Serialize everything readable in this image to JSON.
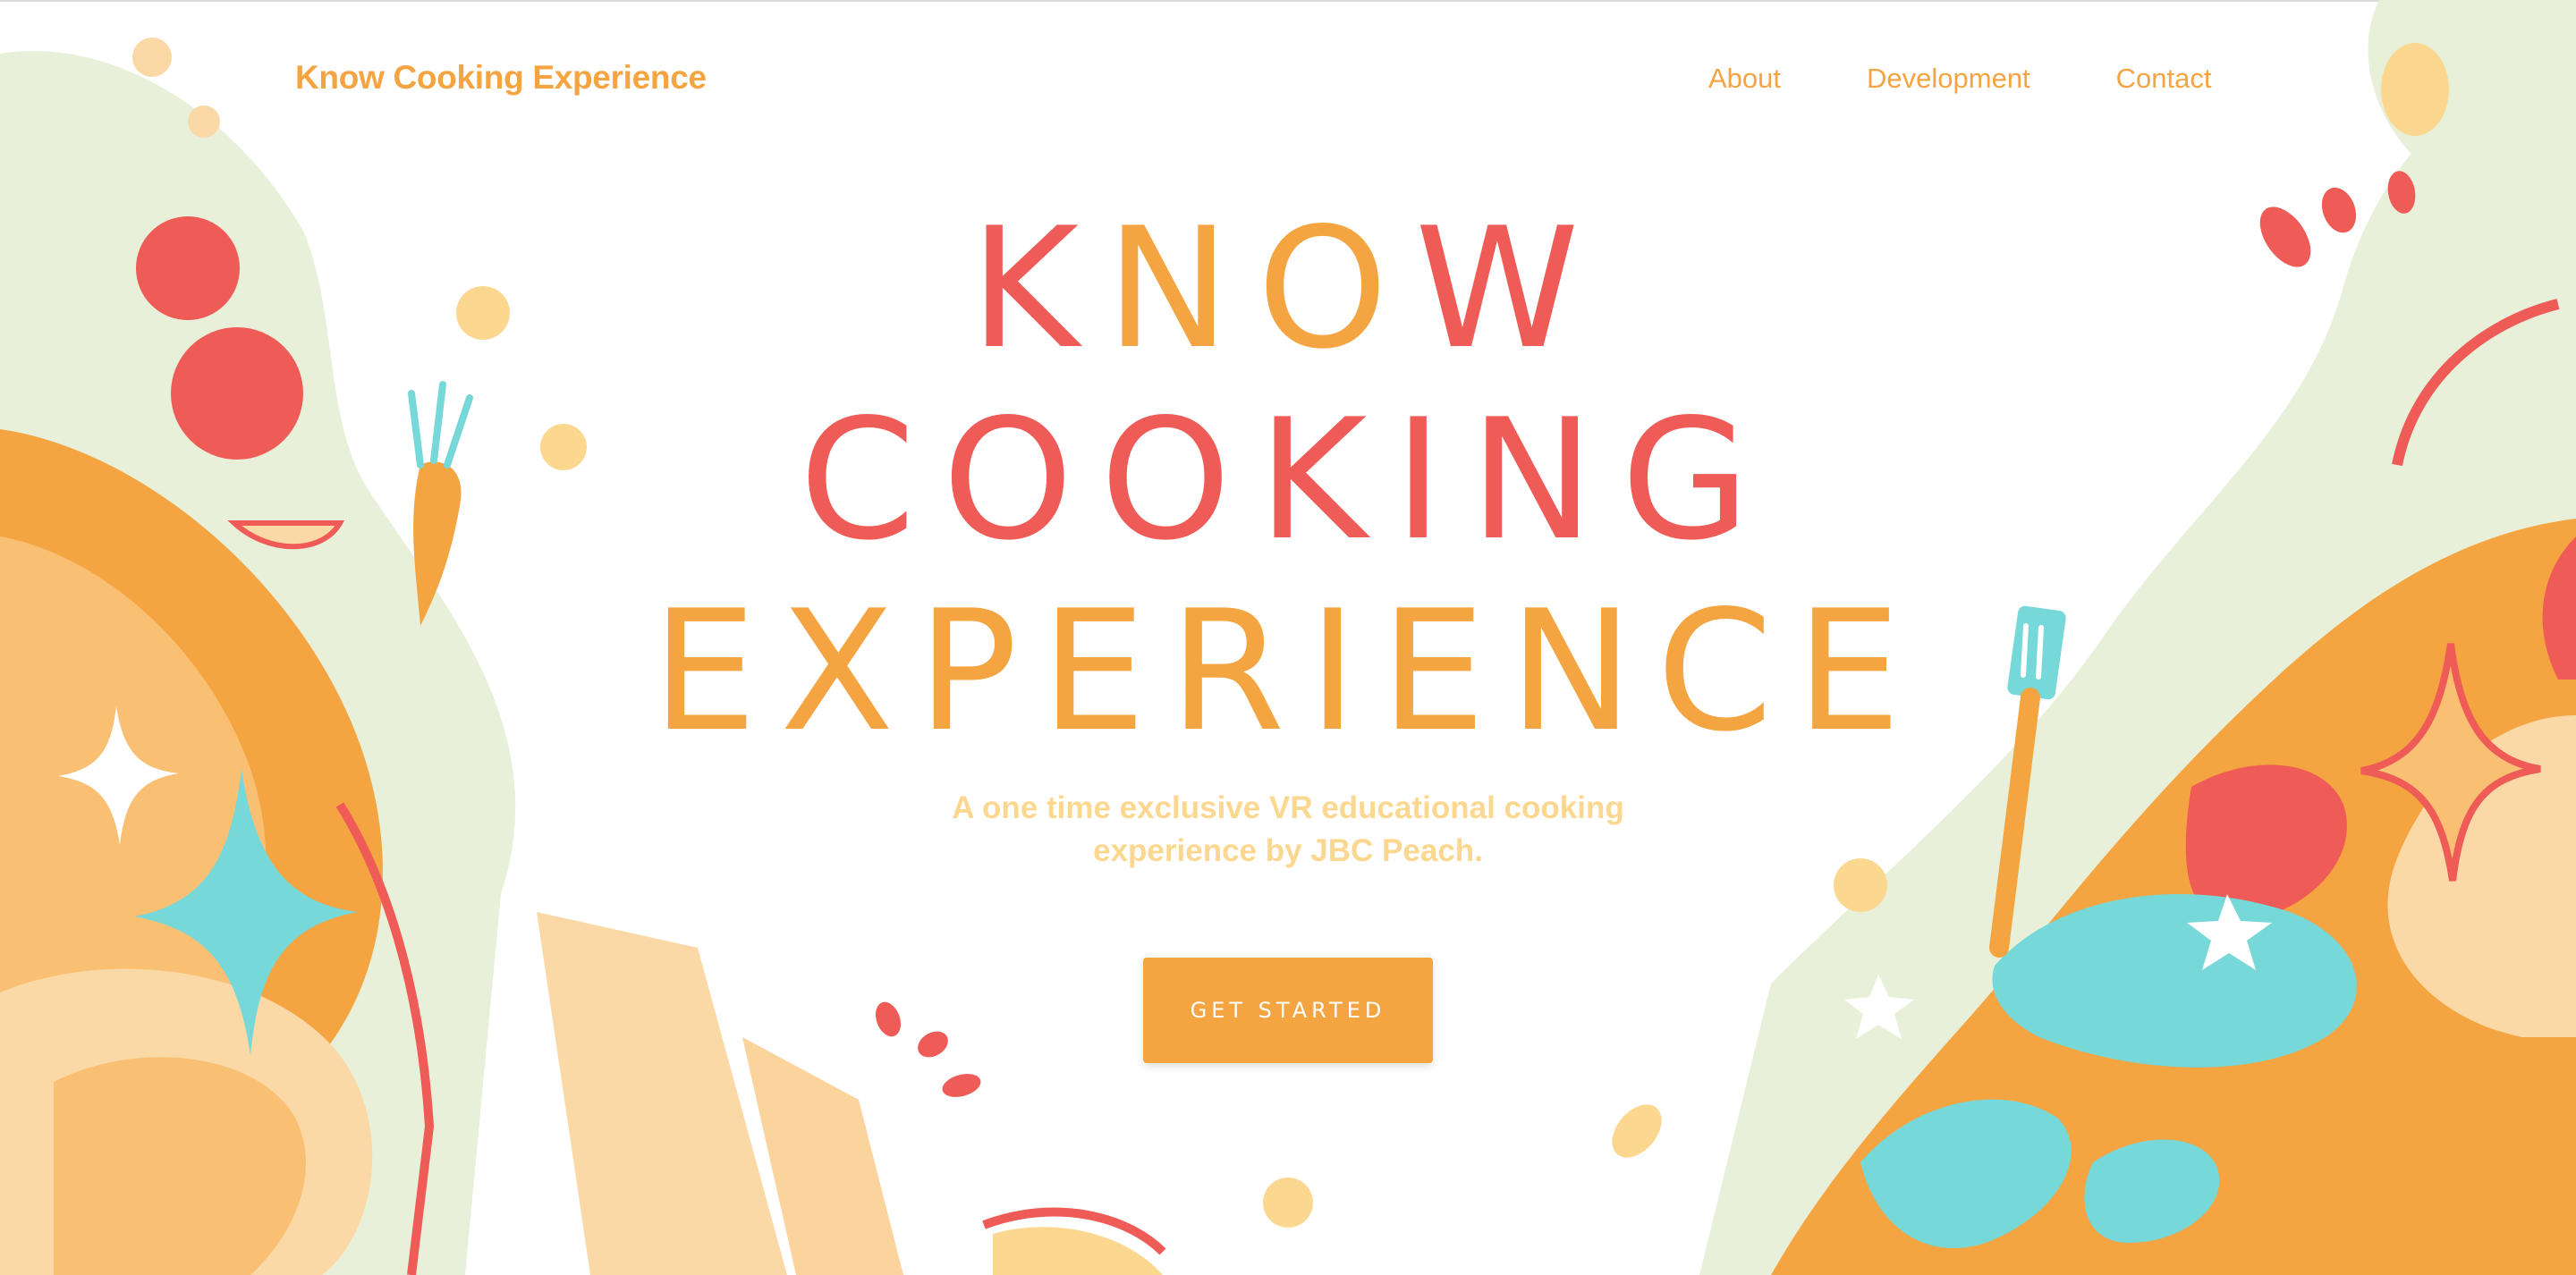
{
  "nav": {
    "brand": "Know Cooking Experience",
    "links": [
      "About",
      "Development",
      "Contact"
    ]
  },
  "hero": {
    "title_lines": [
      "KNOW",
      "COOKING",
      "EXPERIENCE"
    ],
    "subtitle_line1": "A one time exclusive VR educational cooking",
    "subtitle_line2": "experience by JBC Peach.",
    "cta_label": "GET STARTED"
  },
  "colors": {
    "orange": "#f4a542",
    "coral": "#ef5b57",
    "pale_yellow": "#fbd790",
    "pale_green": "#e8f0da",
    "turquoise": "#76d8d8",
    "light_peach": "#fbd9a6"
  }
}
